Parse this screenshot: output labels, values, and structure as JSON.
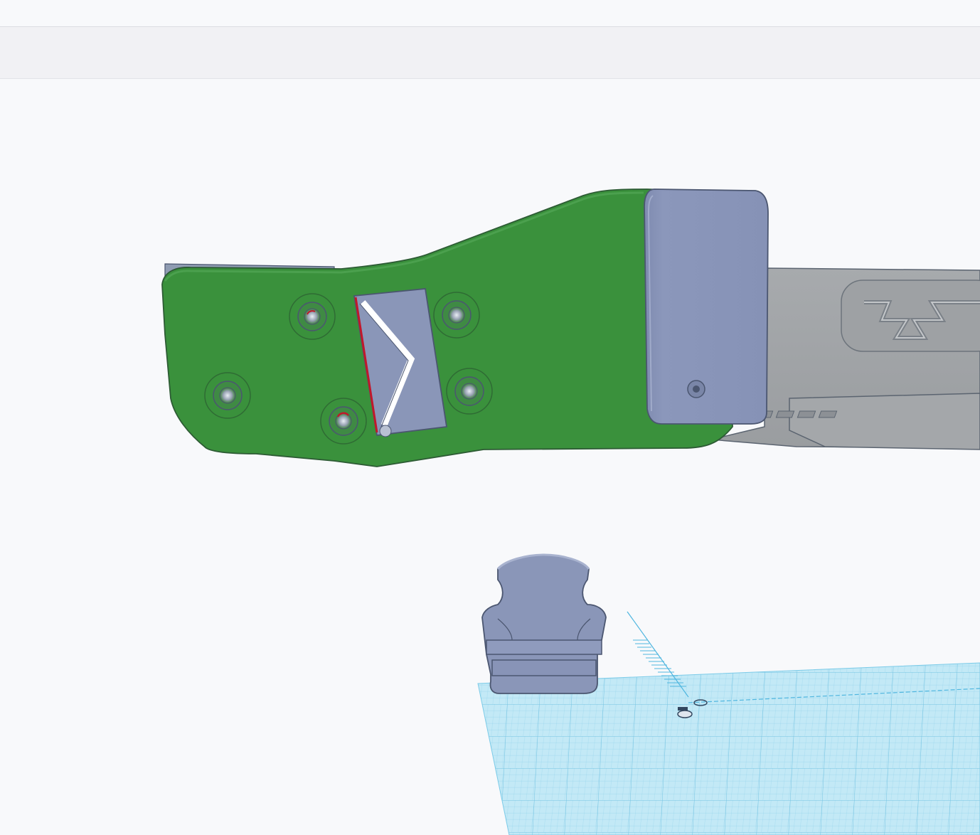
{
  "app": {
    "mode": "3d-design-editor"
  },
  "colors": {
    "background": "#f8f9fb",
    "toolbar": "#f1f1f4",
    "green_part": "#3a913c",
    "grey_part": "#a0a3a6",
    "blue_part": "#8a96b8",
    "outline": "#4b5670",
    "workplane": "#bfe8f5",
    "workplane_grid": "#7cc8e6",
    "highlight": "#c0182b"
  },
  "scene": {
    "objects": [
      {
        "name": "green-bracket",
        "color": "green"
      },
      {
        "name": "grey-handle",
        "color": "grey"
      },
      {
        "name": "blue-end-cap",
        "color": "blue"
      },
      {
        "name": "blue-clip",
        "color": "blue"
      },
      {
        "name": "workplane-grid",
        "color": "light-blue"
      }
    ]
  }
}
